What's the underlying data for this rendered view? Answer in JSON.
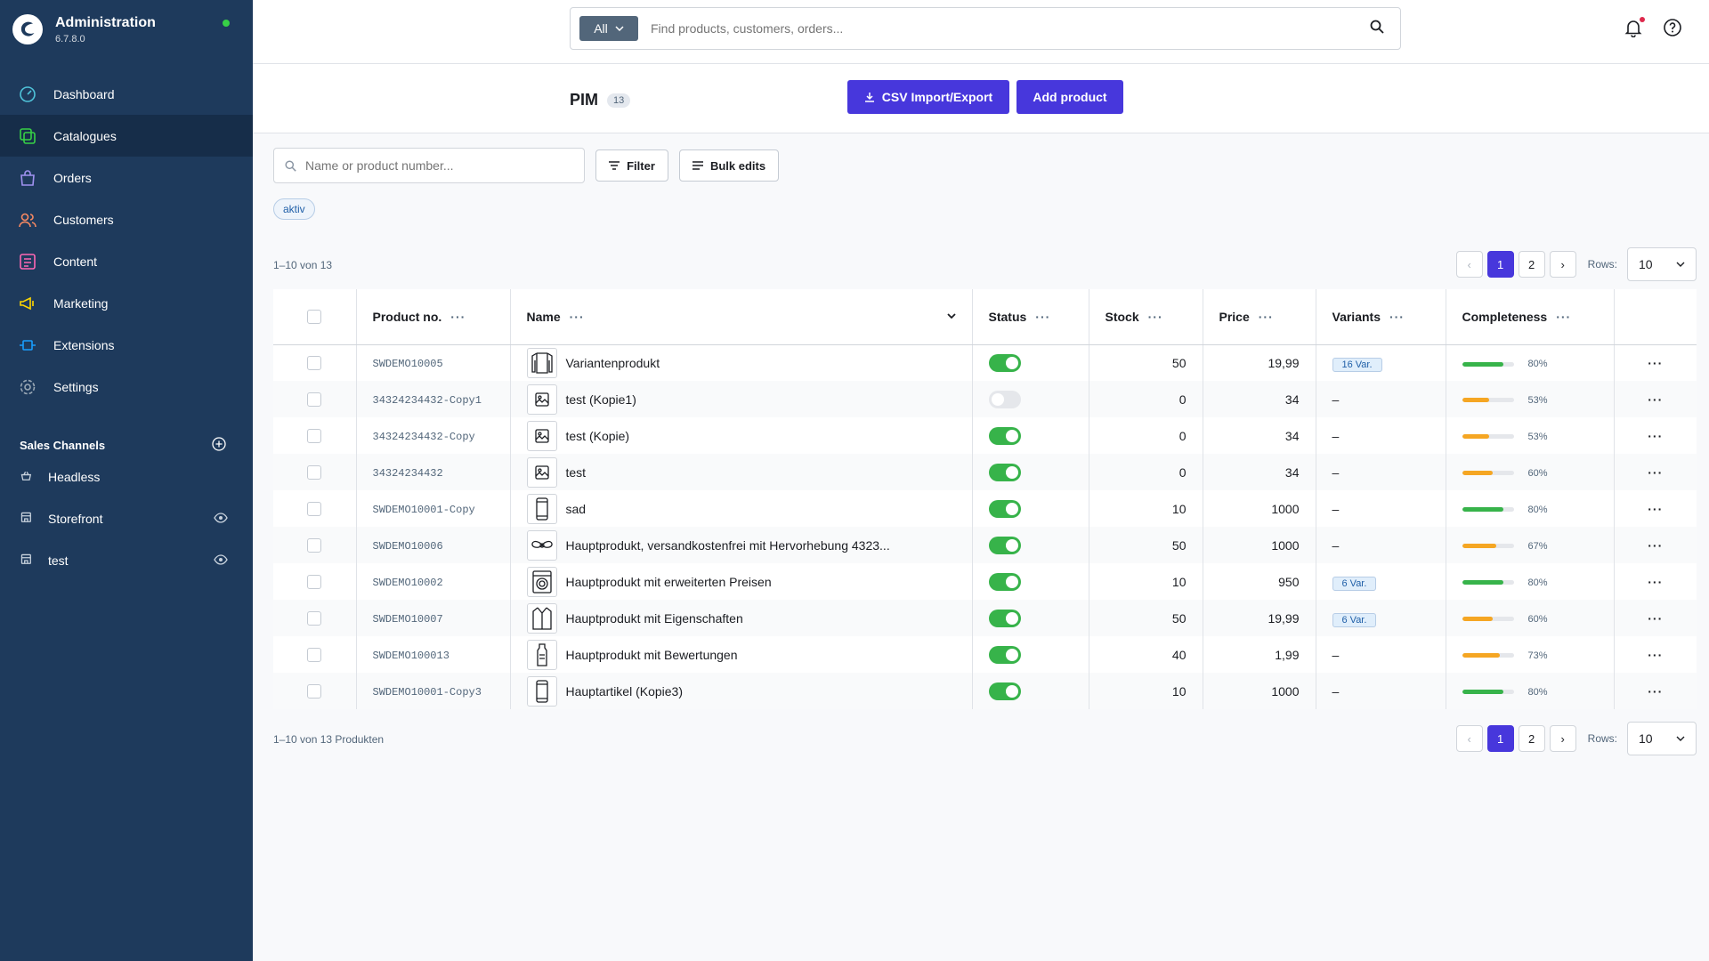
{
  "app": {
    "title": "Administration",
    "version": "6.7.8.0"
  },
  "nav": [
    {
      "label": "Dashboard",
      "icon": "dashboard-icon",
      "color": "#4fc3d9"
    },
    {
      "label": "Catalogues",
      "icon": "catalogue-icon",
      "color": "#37d046",
      "active": true
    },
    {
      "label": "Orders",
      "icon": "orders-icon",
      "color": "#a092f0"
    },
    {
      "label": "Customers",
      "icon": "customers-icon",
      "color": "#f88962"
    },
    {
      "label": "Content",
      "icon": "content-icon",
      "color": "#ff68b4"
    },
    {
      "label": "Marketing",
      "icon": "marketing-icon",
      "color": "#ffd700"
    },
    {
      "label": "Extensions",
      "icon": "extensions-icon",
      "color": "#189eff"
    },
    {
      "label": "Settings",
      "icon": "settings-icon",
      "color": "#9aa8b5"
    }
  ],
  "sales_channels": {
    "title": "Sales Channels",
    "items": [
      {
        "label": "Headless",
        "icon": "basket-icon"
      },
      {
        "label": "Storefront",
        "icon": "storefront-icon",
        "eye": true
      },
      {
        "label": "test",
        "icon": "storefront-icon",
        "eye": true
      }
    ]
  },
  "search": {
    "type": "All",
    "placeholder": "Find products, customers, orders..."
  },
  "page": {
    "title": "PIM",
    "count": "13",
    "csv_label": "CSV Import/Export",
    "add_label": "Add product"
  },
  "list": {
    "search_placeholder": "Name or product number...",
    "filter_label": "Filter",
    "bulk_label": "Bulk edits",
    "chip": "aktiv",
    "range_top": "1–10 von 13",
    "range_bottom": "1–10 von 13 Produkten"
  },
  "pagination": {
    "prev": "‹",
    "pages": [
      "1",
      "2"
    ],
    "next": "›",
    "rows_label": "Rows:",
    "rows_value": "10"
  },
  "columns": {
    "product_no": "Product no.",
    "name": "Name",
    "status": "Status",
    "stock": "Stock",
    "price": "Price",
    "variants": "Variants",
    "completeness": "Completeness"
  },
  "colors": {
    "accent": "#4737dc",
    "sidebar": "#1e3a5c",
    "green": "#37b34a",
    "orange": "#f5a623"
  },
  "rows": [
    {
      "no": "SWDEMO10005",
      "name": "Variantenprodukt",
      "thumb": "longsleeve-icon",
      "active": true,
      "stock": "50",
      "price": "19,99",
      "variants": "16 Var.",
      "completeness": 80,
      "pct": "80%"
    },
    {
      "no": "34324234432-Copy1",
      "name": "test (Kopie1)",
      "thumb": "image-placeholder-icon",
      "active": false,
      "stock": "0",
      "price": "34",
      "variants": "–",
      "completeness": 53,
      "pct": "53%"
    },
    {
      "no": "34324234432-Copy",
      "name": "test (Kopie)",
      "thumb": "image-placeholder-icon",
      "active": true,
      "stock": "0",
      "price": "34",
      "variants": "–",
      "completeness": 53,
      "pct": "53%"
    },
    {
      "no": "34324234432",
      "name": "test",
      "thumb": "image-placeholder-icon",
      "active": true,
      "stock": "0",
      "price": "34",
      "variants": "–",
      "completeness": 60,
      "pct": "60%"
    },
    {
      "no": "SWDEMO10001-Copy",
      "name": "sad",
      "thumb": "phone-icon",
      "active": true,
      "stock": "10",
      "price": "1000",
      "variants": "–",
      "completeness": 80,
      "pct": "80%"
    },
    {
      "no": "SWDEMO10006",
      "name": "Hauptprodukt, versandkostenfrei mit Hervorhebung 4323...",
      "thumb": "bow-icon",
      "active": true,
      "stock": "50",
      "price": "1000",
      "variants": "–",
      "completeness": 67,
      "pct": "67%"
    },
    {
      "no": "SWDEMO10002",
      "name": "Hauptprodukt mit erweiterten Preisen",
      "thumb": "washing-machine-icon",
      "active": true,
      "stock": "10",
      "price": "950",
      "variants": "6 Var.",
      "completeness": 80,
      "pct": "80%"
    },
    {
      "no": "SWDEMO10007",
      "name": "Hauptprodukt mit Eigenschaften",
      "thumb": "jacket-icon",
      "active": true,
      "stock": "50",
      "price": "19,99",
      "variants": "6 Var.",
      "completeness": 60,
      "pct": "60%"
    },
    {
      "no": "SWDEMO100013",
      "name": "Hauptprodukt mit Bewertungen",
      "thumb": "bottle-icon",
      "active": true,
      "stock": "40",
      "price": "1,99",
      "variants": "–",
      "completeness": 73,
      "pct": "73%"
    },
    {
      "no": "SWDEMO10001-Copy3",
      "name": "Hauptartikel (Kopie3)",
      "thumb": "phone-icon",
      "active": true,
      "stock": "10",
      "price": "1000",
      "variants": "–",
      "completeness": 80,
      "pct": "80%"
    }
  ]
}
